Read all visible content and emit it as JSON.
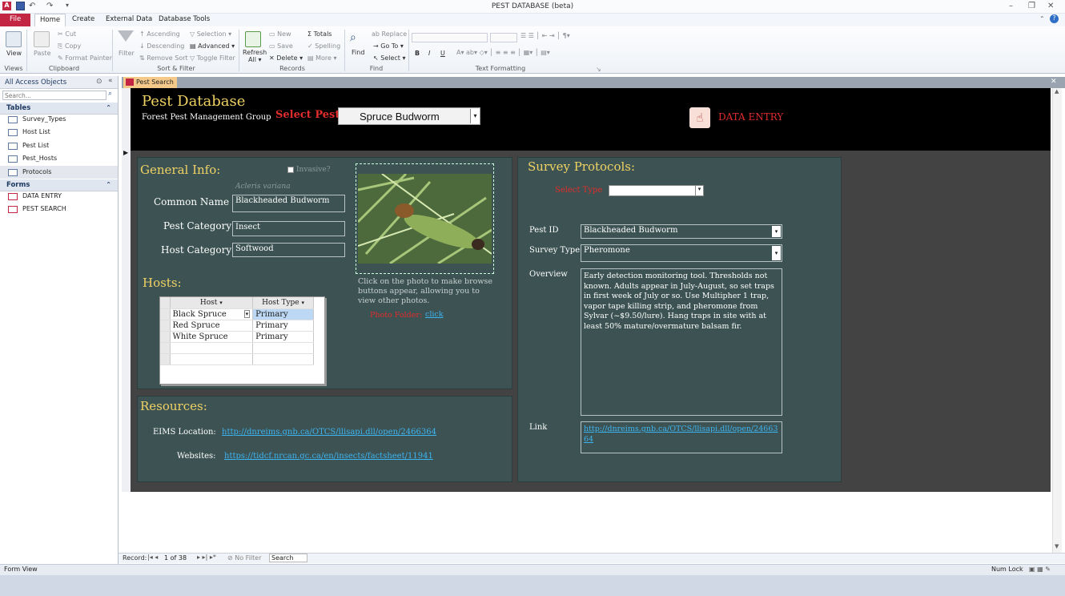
{
  "window": {
    "title": "PEST DATABASE (beta)"
  },
  "ribbon_tabs": [
    "File",
    "Home",
    "Create",
    "External Data",
    "Database Tools"
  ],
  "ribbon": {
    "views": {
      "view": "View",
      "group": "Views"
    },
    "clipboard": {
      "paste": "Paste",
      "cut": "Cut",
      "copy": "Copy",
      "format_painter": "Format Painter",
      "group": "Clipboard"
    },
    "sort_filter": {
      "filter": "Filter",
      "ascending": "Ascending",
      "descending": "Descending",
      "remove_sort": "Remove Sort",
      "selection": "Selection",
      "advanced": "Advanced",
      "toggle_filter": "Toggle Filter",
      "group": "Sort & Filter"
    },
    "records": {
      "refresh": "Refresh",
      "refresh2": "All",
      "new": "New",
      "save": "Save",
      "delete": "Delete",
      "totals": "Totals",
      "spelling": "Spelling",
      "more": "More",
      "group": "Records"
    },
    "find": {
      "find": "Find",
      "replace": "Replace",
      "goto": "Go To",
      "select": "Select",
      "group": "Find"
    },
    "text_formatting": {
      "group": "Text Formatting",
      "bold": "B",
      "italic": "I",
      "underline": "U"
    }
  },
  "nav": {
    "header": "All Access Objects",
    "search_placeholder": "Search...",
    "tables_header": "Tables",
    "tables": [
      "Survey_Types",
      "Host List",
      "Pest List",
      "Pest_Hosts",
      "Protocols"
    ],
    "forms_header": "Forms",
    "forms": [
      "DATA ENTRY",
      "PEST SEARCH"
    ]
  },
  "doc_tab": "Pest Search",
  "form": {
    "title": "Pest Database",
    "subtitle": "Forest Pest Management Group",
    "select_pest_label": "Select Pest",
    "select_pest_value": "Spruce Budworm",
    "data_entry": "DATA ENTRY",
    "general_info": "General Info:",
    "invasive": "Invasive?",
    "latin_name": "Acleris variana",
    "common_name_label": "Common Name",
    "common_name": "Blackheaded Budworm",
    "pest_category_label": "Pest Category",
    "pest_category": "Insect",
    "host_category_label": "Host Category",
    "host_category": "Softwood",
    "hosts_title": "Hosts:",
    "hosts_columns": [
      "Host",
      "Host Type"
    ],
    "hosts_rows": [
      [
        "Black Spruce",
        "Primary"
      ],
      [
        "Red Spruce",
        "Primary"
      ],
      [
        "White Spruce",
        "Primary"
      ]
    ],
    "photo_help": "Click on the photo to make browse buttons appear, allowing you to view other photos.",
    "photo_folder_label": "Photo Folder:",
    "photo_folder_link": "click",
    "resources_title": "Resources:",
    "eims_label": "EIMS Location:",
    "eims_link": "http://dnreims.gnb.ca/OTCS/llisapi.dll/open/2466364",
    "websites_label": "Websites:",
    "websites_link": "https://tidcf.nrcan.gc.ca/en/insects/factsheet/11941",
    "survey_title": "Survey Protocols:",
    "select_type_label": "Select Type",
    "select_type_value": "",
    "pest_id_label": "Pest ID",
    "pest_id": "Blackheaded Budworm",
    "survey_type_label": "Survey Type",
    "survey_type": "Pheromone",
    "overview_label": "Overview",
    "overview": "Early detection monitoring tool. Thresholds not known. Adults appear in July-August, so set traps in first week of July or so. Use Multipher 1 trap, vapor tape killing strip, and pheromone from Sylvar (~$9.50/lure). Hang traps in site with at least 50% mature/overmature balsam fir.",
    "link_label": "Link",
    "link_value": "http://dnreims.gnb.ca/OTCS/llisapi.dll/open/2466364"
  },
  "record_nav": {
    "label": "Record:",
    "position": "1 of 38",
    "no_filter": "No Filter",
    "search": "Search"
  },
  "status": {
    "view": "Form View",
    "numlock": "Num Lock"
  },
  "colors": {
    "panel": "#3d5353",
    "gold": "#f0d264",
    "red": "#e02c2c",
    "file_tab": "#c32643"
  }
}
